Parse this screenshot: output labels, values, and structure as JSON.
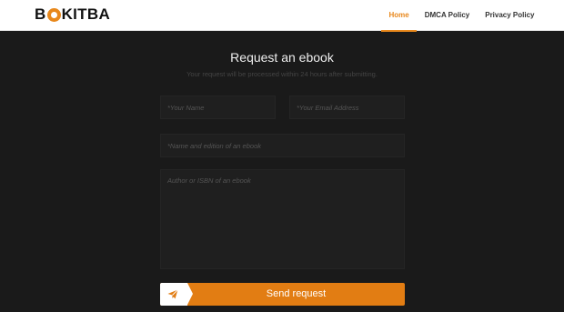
{
  "header": {
    "logo": {
      "text_before": "B",
      "text_after": "KITBA"
    },
    "nav": [
      {
        "label": "Home",
        "active": true
      },
      {
        "label": "DMCA Policy",
        "active": false
      },
      {
        "label": "Privacy Policy",
        "active": false
      }
    ]
  },
  "form": {
    "title": "Request an ebook",
    "subtitle": "Your request will be processed within 24 hours after submitting.",
    "name_placeholder": "*Your Name",
    "email_placeholder": "*Your Email Address",
    "ebook_placeholder": "*Name and edition of an ebook",
    "author_placeholder": "Author or ISBN of an ebook",
    "submit_label": "Send request",
    "submit_icon": "paper-plane-icon"
  },
  "colors": {
    "accent": "#e8881c",
    "button": "#e27d13",
    "background": "#1a1a1a",
    "header_bg": "#ffffff"
  }
}
